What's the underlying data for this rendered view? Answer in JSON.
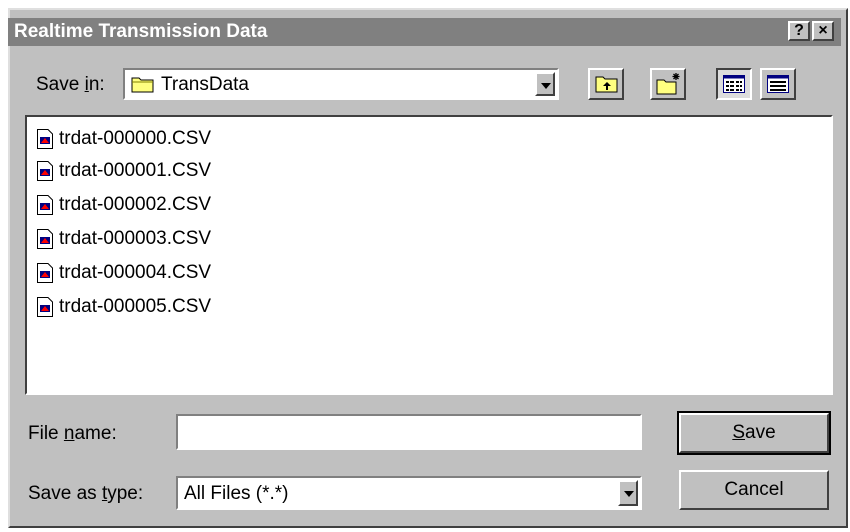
{
  "window": {
    "title": "Realtime Transmission Data",
    "help_glyph": "?",
    "close_glyph": "×"
  },
  "save_in": {
    "label_pre": "Save ",
    "label_accel": "i",
    "label_post": "n:",
    "value": "TransData"
  },
  "toolbar": {
    "up_one_level_icon": "folder-up-icon",
    "new_folder_icon": "new-folder-icon",
    "list_view_icon": "list-view-icon",
    "details_view_icon": "details-view-icon"
  },
  "files": [
    "trdat-000000.CSV",
    "trdat-000001.CSV",
    "trdat-000002.CSV",
    "trdat-000003.CSV",
    "trdat-000004.CSV",
    "trdat-000005.CSV"
  ],
  "file_name": {
    "label_pre": "File ",
    "label_accel": "n",
    "label_post": "ame:",
    "value": ""
  },
  "save_as_type": {
    "label_pre": "Save as ",
    "label_accel": "t",
    "label_post": "ype:",
    "value": "All Files (*.*)"
  },
  "buttons": {
    "save_accel": "S",
    "save_rest": "ave",
    "cancel": "Cancel"
  },
  "colors": {
    "face": "#c0c0c0",
    "title_bg": "#808080"
  }
}
